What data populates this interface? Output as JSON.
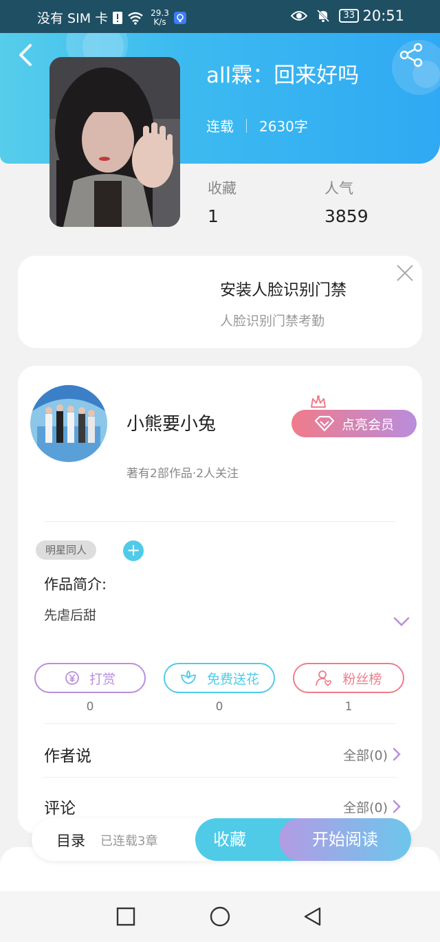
{
  "status_bar": {
    "carrier": "没有 SIM 卡",
    "net_speed_value": "29.3",
    "net_speed_unit": "K/s",
    "battery": "33",
    "time": "20:51"
  },
  "book": {
    "title": "all霖：回来好吗",
    "status": "连载",
    "word_count": "2630字",
    "collect_label": "收藏",
    "collect_value": "1",
    "popularity_label": "人气",
    "popularity_value": "3859"
  },
  "ad": {
    "title": "安装人脸识别门禁",
    "subtitle": "人脸识别门禁考勤"
  },
  "author": {
    "name": "小熊要小兔",
    "info": "著有2部作品·2人关注",
    "vip_label": "点亮会员"
  },
  "tags": [
    "明星同人"
  ],
  "tag_add": "+",
  "intro": {
    "label": "作品简介:",
    "text": "先虐后甜"
  },
  "actions": [
    {
      "label": "打赏",
      "count": "0",
      "color": "#b98ddc"
    },
    {
      "label": "免费送花",
      "count": "0",
      "color": "#4fcbe8"
    },
    {
      "label": "粉丝榜",
      "count": "1",
      "color": "#f07b8a"
    }
  ],
  "sections": [
    {
      "title": "作者说",
      "link": "全部(0)"
    },
    {
      "title": "评论",
      "link": "全部(0)"
    }
  ],
  "bottom": {
    "toc_label": "目录",
    "toc_sub": "已连载3章",
    "collect_button": "收藏",
    "read_button": "开始阅读"
  },
  "colors": {
    "accent": "#4fcbe8",
    "purple": "#b98ddc",
    "pink": "#f07b8a",
    "header": "#3dbbf0"
  }
}
